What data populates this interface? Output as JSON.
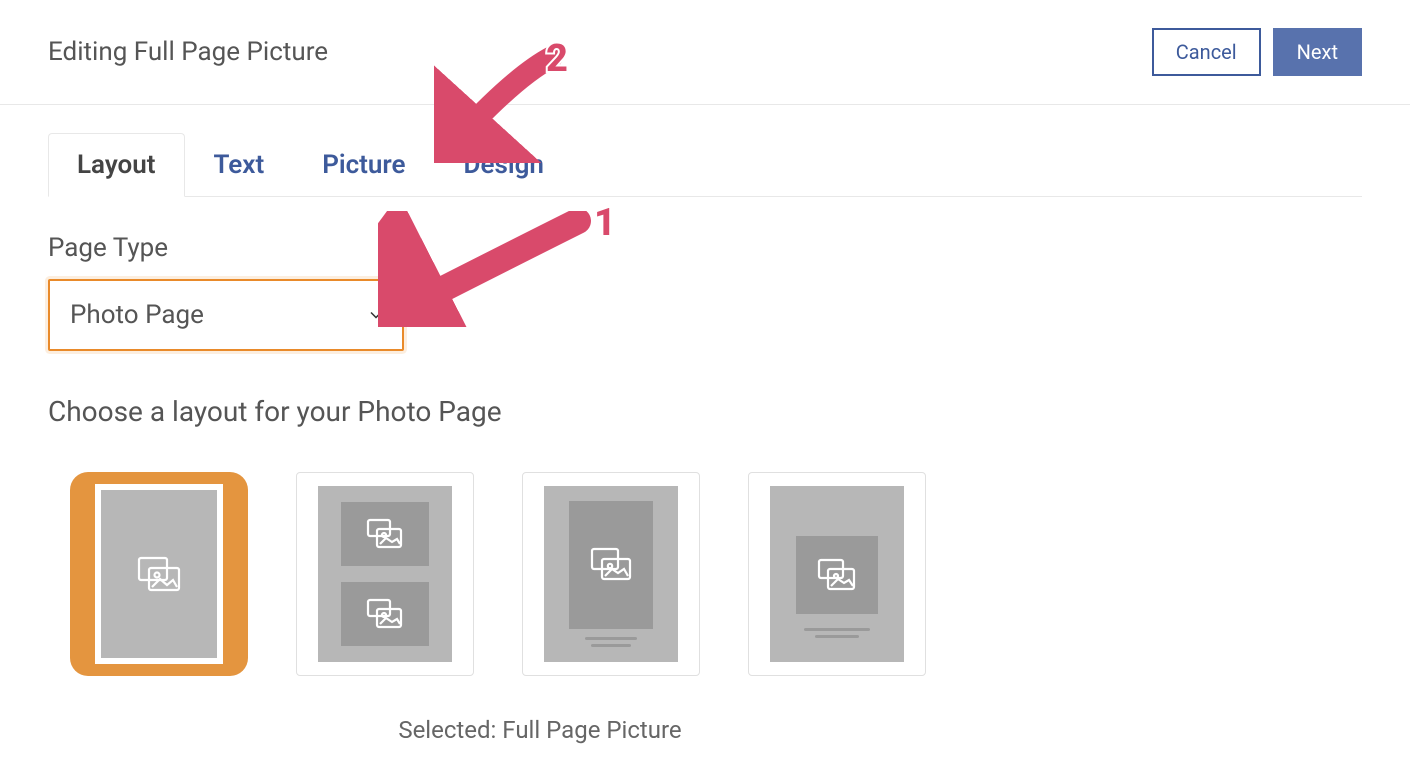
{
  "header": {
    "title": "Editing Full Page Picture",
    "cancel_label": "Cancel",
    "next_label": "Next"
  },
  "tabs": {
    "layout": "Layout",
    "text": "Text",
    "picture": "Picture",
    "design": "Design"
  },
  "page_type": {
    "label": "Page Type",
    "value": "Photo Page"
  },
  "instruction": "Choose a layout for your Photo Page",
  "selected_label": "Selected: Full Page Picture",
  "annotations": {
    "one": "1",
    "two": "2"
  },
  "colors": {
    "accent": "#3d5a9b",
    "highlight": "#e4953f",
    "annotation": "#d94a6b"
  }
}
